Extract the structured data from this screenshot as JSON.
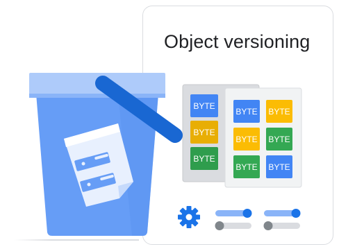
{
  "card": {
    "title": "Object versioning"
  },
  "tiles": {
    "back_sheet": [
      "BYTE",
      "BYTE",
      "BYTE"
    ],
    "front_sheet": [
      "BYTE",
      "BYTE",
      "BYTE",
      "BYTE",
      "BYTE",
      "BYTE"
    ]
  },
  "icons": {
    "bucket": "storage-bucket-icon",
    "document": "document-sticker-icon",
    "settings": "gear-icon",
    "toggles": "toggle-switch-icon"
  },
  "colors": {
    "blue": "#4285f4",
    "yellow": "#fbbc04",
    "green": "#34a853",
    "bucket_light": "#aecbfa",
    "bucket_dark": "#1a73e8",
    "gray_sheet": "#e8eaed"
  }
}
